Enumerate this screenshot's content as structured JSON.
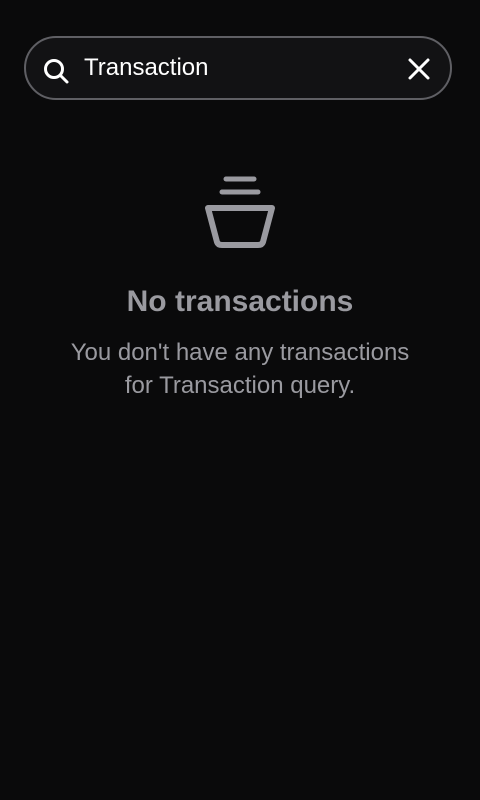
{
  "search": {
    "value": "Transaction",
    "icon": "search-icon",
    "clear_icon": "close-icon"
  },
  "empty_state": {
    "icon": "basket-icon",
    "title": "No transactions",
    "message": "You don't have any transactions for Transaction query."
  },
  "colors": {
    "background": "#0a0a0b",
    "search_border": "#5f5f64",
    "search_fill": "#121214",
    "muted_text": "#9a9aa0",
    "primary_text": "#ffffff"
  }
}
